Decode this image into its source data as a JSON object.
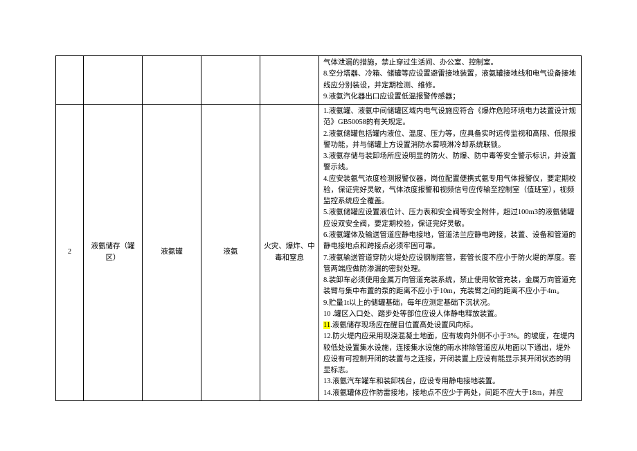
{
  "rows": [
    {
      "num": "",
      "a": "",
      "b": "",
      "c": "",
      "d": "",
      "content_lines": [
        "气体泄漏的措施，禁止穿过生活间、办公室、控制室。",
        "8.空分塔器、冷箱、储罐等应设置避雷接地装置，液氨罐接地线和电气设备接地线应分别装设，并定期检测、维修。",
        "9.液氨汽化器出口应设置低温报警传感器；"
      ]
    },
    {
      "num": "2",
      "a": "液氨储存（罐区）",
      "b": "液氨罐",
      "c": "液氨",
      "d": "火灾、爆炸、中毒和窒息",
      "content_lines": [
        "1.液氨罐、液氨中间储罐区域内电气设施应符合《爆炸危险环境电力装置设计规范》GB50058的有关规定。",
        "2.液氨储罐包括罐内液位、温度、压力等，应具备实时远传监视和高限、低限报警功能，并与储罐上方设置消防水雾喷淋冷却系统联锁。",
        "3.液氨存储与装卸场所应设明显的防火、防爆、防中毒等安全警示标识，并设置警示线。",
        "4.应安装氨气浓度检测报警仪器，岗位配置便携式氨专用气体报警仪，要定期校验，保证完好灵敏，气体浓度报警和视频信号应传输至控制室（值班室），视频监控系统应全覆盖。",
        "5.液氨储罐应设置液位计、压力表和安全阀等安全附件，超过100m3的液氨储罐应设双安全阀，要定期校验，保证完好灵敏。",
        "6.液氨罐体及输送管道应静电接地，管道法兰应静电跨接，装置、设备和管道的静电接地点和跨接点必须牢固可靠。",
        "7.液氨输送管道穿防火堤处应设钢制套管，套管长度不应小于防火堤的厚度。套管两端应做防渗漏的密封处理。",
        "8.装卸车必须使用金属万向管道充装系统，禁止使用软管充装，金属万向管道充装臂与集中布置的泵的距离不应小于10m，充装臂之间的距离不应小于4m。",
        "9.贮量1t以上的储罐基础，每年应测定基础下沉状况。",
        "10       .罐区入口处、踏步处等部位应设人体静电释放装置。",
        "||HL_START||11||HL_END||.液氨储存现场应在醒目位置高处设置风向标。",
        "12.防火堤内应采用现浇混凝土地面，应有坡向外侧不小于3%。的坡度，在堤内较低处设置集水设施，连接集水设施的雨水排除管道应从地面以下通出，堤外应设有可控制开闭的装置与之连接，开闭装置上应设有能显示其开闭状态的明显标志。",
        "13.液氨汽车罐车和装卸栈台，应设专用静电接地装置。",
        "14.液氨罐体应作防雷接地，接地点不应少于两处，间距不应大于18m，并应"
      ]
    }
  ]
}
